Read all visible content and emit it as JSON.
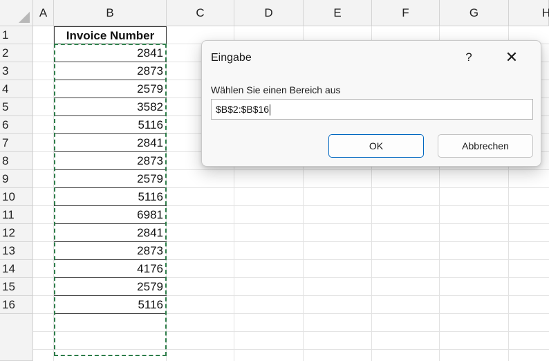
{
  "columns": [
    "A",
    "B",
    "C",
    "D",
    "E",
    "F",
    "G",
    "H"
  ],
  "rows": [
    "1",
    "2",
    "3",
    "4",
    "5",
    "6",
    "7",
    "8",
    "9",
    "10",
    "11",
    "12",
    "13",
    "14",
    "15",
    "16"
  ],
  "column_b": {
    "header": "Invoice Number",
    "values": [
      "2841",
      "2873",
      "2579",
      "3582",
      "5116",
      "2841",
      "2873",
      "2579",
      "5116",
      "6981",
      "2841",
      "2873",
      "4176",
      "2579",
      "5116"
    ]
  },
  "dialog": {
    "title": "Eingabe",
    "help": "?",
    "close": "✕",
    "prompt": "Wählen Sie einen Bereich aus",
    "input_value": "$B$2:$B$16",
    "ok_label": "OK",
    "cancel_label": "Abbrechen"
  },
  "colors": {
    "marquee": "#2e7d4a",
    "ok_border": "#0067c0",
    "header_bg": "#f3f3f3"
  }
}
